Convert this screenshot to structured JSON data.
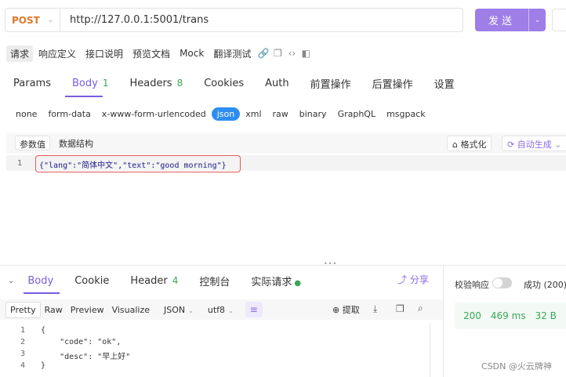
{
  "request": {
    "method": "POST",
    "url": "http://127.0.0.1:5001/trans",
    "send_label": "发送"
  },
  "subtabs": [
    "请求",
    "响应定义",
    "接口说明",
    "预览文档",
    "Mock",
    "翻译测试"
  ],
  "main_tabs": {
    "params": "Params",
    "body": "Body",
    "body_count": "1",
    "headers": "Headers",
    "headers_count": "8",
    "cookies": "Cookies",
    "auth": "Auth",
    "pre": "前置操作",
    "post": "后置操作",
    "settings": "设置"
  },
  "body_types": [
    "none",
    "form-data",
    "x-www-form-urlencoded",
    "json",
    "xml",
    "raw",
    "binary",
    "GraphQL",
    "msgpack"
  ],
  "param_bar": {
    "params_value": "参数值",
    "data_structure": "数据结构",
    "format": "格式化",
    "autogen": "自动生成"
  },
  "editor": {
    "line": "1",
    "code": "{\"lang\":\"简体中文\",\"text\":\"good morning\"}"
  },
  "response": {
    "tabs": {
      "body": "Body",
      "cookie": "Cookie",
      "header": "Header",
      "header_count": "4",
      "console": "控制台",
      "actual": "实际请求"
    },
    "share": "分享",
    "view": {
      "pretty": "Pretty",
      "raw": "Raw",
      "preview": "Preview",
      "visualize": "Visualize",
      "format": "JSON",
      "encoding": "utf8"
    },
    "extract": "提取",
    "validate": "校验响应",
    "success": "成功 (200)",
    "status": "200",
    "time": "469 ms",
    "size": "32 B",
    "lines": [
      {
        "n": "1",
        "text": "{"
      },
      {
        "n": "2",
        "text": "    \"code\": \"ok\","
      },
      {
        "n": "3",
        "text": "    \"desc\": \"早上好\""
      },
      {
        "n": "4",
        "text": "}"
      }
    ]
  },
  "watermark": "CSDN @火云牌神",
  "colors": {
    "accent": "#7a5ce0",
    "send": "#9f7ee8",
    "json_active": "#2e8ef0",
    "success": "#3aa757",
    "method": "#e0782a"
  }
}
